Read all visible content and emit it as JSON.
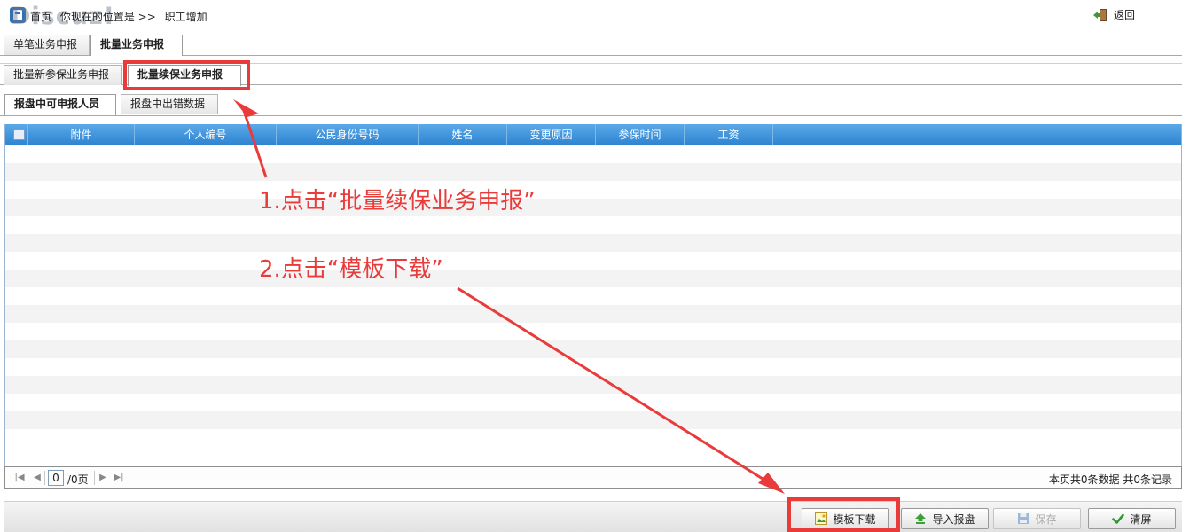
{
  "header": {
    "breadcrumb_home": "首页",
    "breadcrumb_prefix": "你现在的位置是 >>",
    "breadcrumb_current": "职工增加",
    "back_label": "返回",
    "watermark": "Discuz!"
  },
  "tabs_level1": [
    {
      "label": "单笔业务申报",
      "active": false
    },
    {
      "label": "批量业务申报",
      "active": true
    }
  ],
  "tabs_level2": [
    {
      "label": "批量新参保业务申报",
      "active": false
    },
    {
      "label": "批量续保业务申报",
      "active": true
    }
  ],
  "tabs_level3": [
    {
      "label": "报盘中可申报人员",
      "active": true
    },
    {
      "label": "报盘中出错数据",
      "active": false
    }
  ],
  "grid": {
    "columns": [
      "附件",
      "个人编号",
      "公民身份号码",
      "姓名",
      "变更原因",
      "参保时间",
      "工资"
    ],
    "rows": []
  },
  "pager": {
    "current_page": "0",
    "total_pages": "/0页",
    "summary": "本页共0条数据 共0条记录"
  },
  "toolbar": {
    "template_download": "模板下载",
    "import": "导入报盘",
    "save": "保存",
    "clear": "清屏"
  },
  "annotations": {
    "step1": "1.点击“批量续保业务申报”",
    "step2": "2.点击“模板下载”"
  },
  "colors": {
    "header_bar": "#2d83d1",
    "annotation_red": "#ea3b3b",
    "row_alt": "#f3f3f3"
  }
}
